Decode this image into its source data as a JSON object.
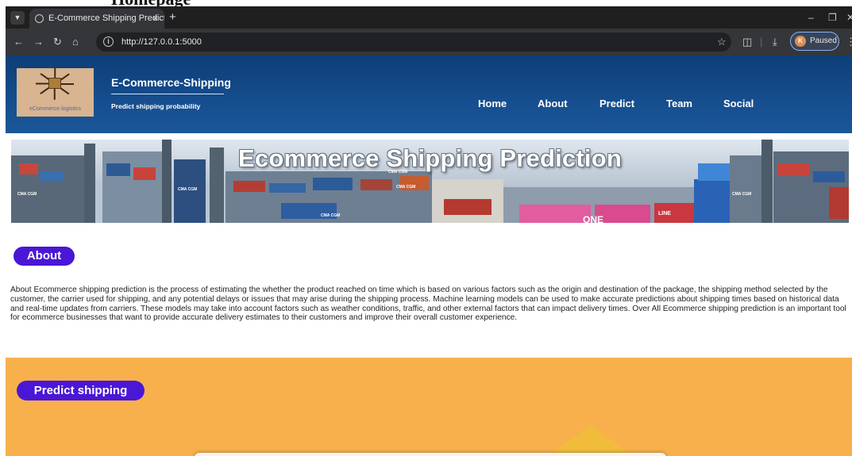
{
  "doc_heading": "Homepage",
  "browser": {
    "tab_title": "E-Commerce Shipping Predicti",
    "tab_close": "×",
    "new_tab": "+",
    "url": "http://127.0.0.1:5000",
    "profile_initial": "K",
    "profile_status": "Paused",
    "icons": [
      "tab-menu-icon",
      "favicon-icon",
      "back-icon",
      "forward-icon",
      "reload-icon",
      "home-icon",
      "info-icon",
      "star-icon",
      "extensions-icon",
      "download-icon",
      "more-icon",
      "minimize-icon",
      "maximize-icon",
      "close-icon"
    ]
  },
  "site": {
    "logo_text": "eCommerce logistics",
    "title": "E-Commerce-Shipping",
    "subtitle": "Predict shipping probability",
    "nav": [
      "Home",
      "About",
      "Predict",
      "Team",
      "Social"
    ],
    "header_color": "#0d3e76"
  },
  "banner": {
    "title": "Ecommerce Shipping Prediction",
    "brand_marks": [
      "CMA CGM",
      "CMA CGM",
      "CMA CGM",
      "CMA CGM",
      "CMA CGM",
      "CMA CGM",
      "ONE",
      "LINE"
    ]
  },
  "about": {
    "label": "About",
    "text": "About Ecommerce shipping prediction is the process of estimating the whether the product reached on time which is based on various factors such as the origin and destination of the package, the shipping method selected by the customer, the carrier used for shipping, and any potential delays or issues that may arise during the shipping process. Machine learning models can be used to make accurate predictions about shipping times based on historical data and real-time updates from carriers. These models may take into account factors such as weather conditions, traffic, and other external factors that can impact delivery times. Over All Ecommerce shipping prediction is an important tool for ecommerce businesses that want to provide accurate delivery estimates to their customers and improve their overall customer experience."
  },
  "predict": {
    "label": "Predict shipping",
    "background": "#f8b04d"
  },
  "colors": {
    "pill": "#4a17d6",
    "browser_dark": "#1f1f1f",
    "toolbar": "#35363a"
  }
}
